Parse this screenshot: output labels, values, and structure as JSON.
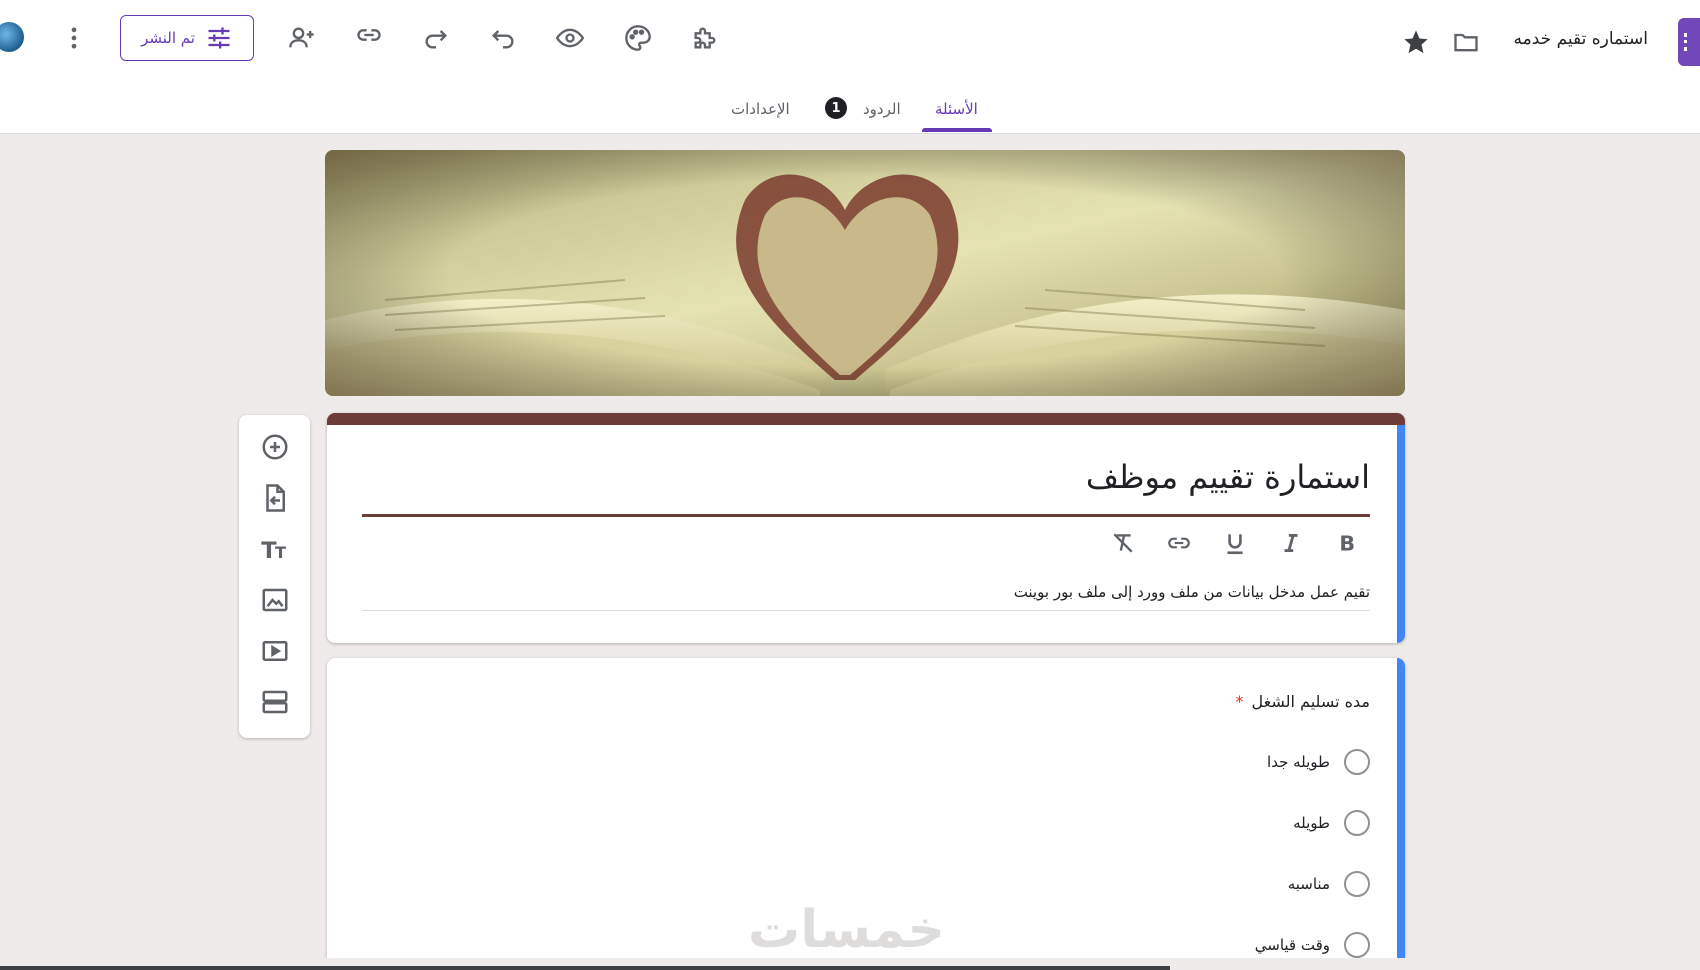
{
  "header": {
    "doc_title": "استماره تقيم خدمه",
    "publish_label": "تم النشر"
  },
  "tabs": [
    {
      "label": "الأسئلة",
      "active": true
    },
    {
      "label": "الردود",
      "badge": "1"
    },
    {
      "label": "الإعدادات"
    }
  ],
  "form": {
    "title": "استمارة تقييم موظف",
    "description": "تقيم عمل مدخل بيانات من ملف وورد إلى ملف بور بوينت"
  },
  "formatting": [
    "bold-icon",
    "italic-icon",
    "underline-icon",
    "link-icon",
    "clear-format-icon"
  ],
  "side_toolbar": [
    "add-question-icon",
    "import-questions-icon",
    "add-title-icon",
    "add-image-icon",
    "add-video-icon",
    "add-section-icon"
  ],
  "question": {
    "title": "مده تسليم الشغل",
    "required_mark": "*",
    "options": [
      "طويله جدا",
      "طويله",
      "مناسبه",
      "وقت قياسي"
    ]
  },
  "watermark": "خمسات",
  "colors": {
    "accent": "#673ab7",
    "theme": "#6d3d3a",
    "focus_bar": "#4285f4"
  }
}
